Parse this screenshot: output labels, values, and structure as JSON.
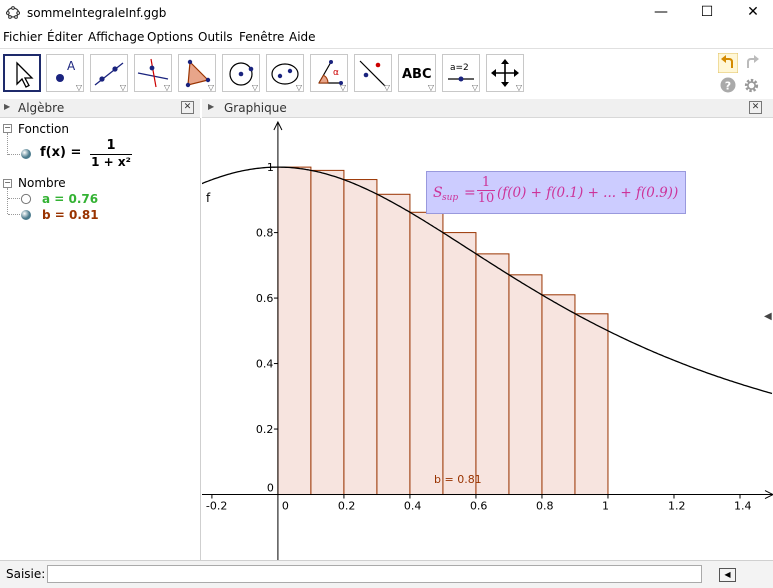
{
  "window": {
    "title": "sommeIntegraleInf.ggb",
    "minimize": "—",
    "maximize": "☐",
    "close": "✕"
  },
  "menu": [
    "Fichier",
    "Éditer",
    "Affichage",
    "Options",
    "Outils",
    "Fenêtre",
    "Aide"
  ],
  "toolbar": {
    "text_tool_label": "ABC",
    "slider_tool_label": "a=2"
  },
  "algebra": {
    "title": "Algèbre",
    "groups": [
      {
        "label": "Fonction",
        "items": [
          {
            "name": "f(x) =",
            "numerator": "1",
            "denominator": "1 + x²"
          }
        ]
      },
      {
        "label": "Nombre",
        "items": [
          {
            "text": "a = 0.76",
            "color": "#33b233"
          },
          {
            "text": "b = 0.81",
            "color": "#993300"
          }
        ]
      }
    ]
  },
  "graphics": {
    "title": "Graphique",
    "function_label": "f",
    "point_label": "b = 0.81",
    "formula": {
      "lhs": "S",
      "lhs_sub": "sup",
      "eq": "=",
      "frac_num": "1",
      "frac_den": "10",
      "rhs": "(f(0) + f(0.1) + ... + f(0.9))"
    },
    "colors": {
      "formula_text": "#cc3399",
      "formula_bg": "#ccccff",
      "rect_fill": "#f7e4df",
      "rect_stroke": "#993300",
      "curve": "#000000"
    }
  },
  "chart_data": {
    "type": "bar",
    "function": "f(x) = 1/(1+x^2)",
    "x_ticks": [
      "-0.2",
      "0",
      "0.2",
      "0.4",
      "0.6",
      "0.8",
      "1",
      "1.2",
      "1.4"
    ],
    "y_ticks": [
      "0",
      "0.2",
      "0.4",
      "0.6",
      "0.8",
      "1"
    ],
    "xlim": [
      -0.23,
      1.5
    ],
    "ylim": [
      -0.2,
      1.15
    ],
    "rect_width": 0.1,
    "x": [
      0,
      0.1,
      0.2,
      0.3,
      0.4,
      0.5,
      0.6,
      0.7,
      0.8,
      0.9
    ],
    "values": [
      1.0,
      0.99,
      0.962,
      0.917,
      0.862,
      0.8,
      0.735,
      0.671,
      0.61,
      0.552
    ]
  },
  "input_bar": {
    "label": "Saisie:",
    "value": ""
  }
}
